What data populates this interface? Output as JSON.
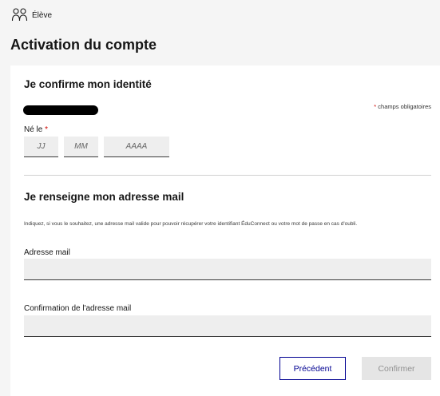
{
  "topbar": {
    "role_label": "Élève",
    "role_icon": "users-icon"
  },
  "page": {
    "title": "Activation du compte"
  },
  "identity": {
    "title": "Je confirme mon identité",
    "required_note_star": "*",
    "required_note": "champs obligatoires",
    "birth_label": "Né le",
    "birth_star": "*",
    "day_placeholder": "JJ",
    "month_placeholder": "MM",
    "year_placeholder": "AAAA"
  },
  "email": {
    "title": "Je renseigne mon adresse mail",
    "help": "Indiquez, si vous le souhaitez, une adresse mail valide pour pouvoir récupérer votre identifiant ÉduConnect ou votre mot de passe en cas d'oubli.",
    "email_label": "Adresse mail",
    "email_value": "",
    "confirm_label": "Confirmation de l'adresse mail",
    "confirm_value": ""
  },
  "actions": {
    "previous_label": "Précédent",
    "confirm_label": "Confirmer"
  },
  "colors": {
    "primary": "#000091",
    "required": "#ce0500",
    "disabled_text": "#929292"
  }
}
